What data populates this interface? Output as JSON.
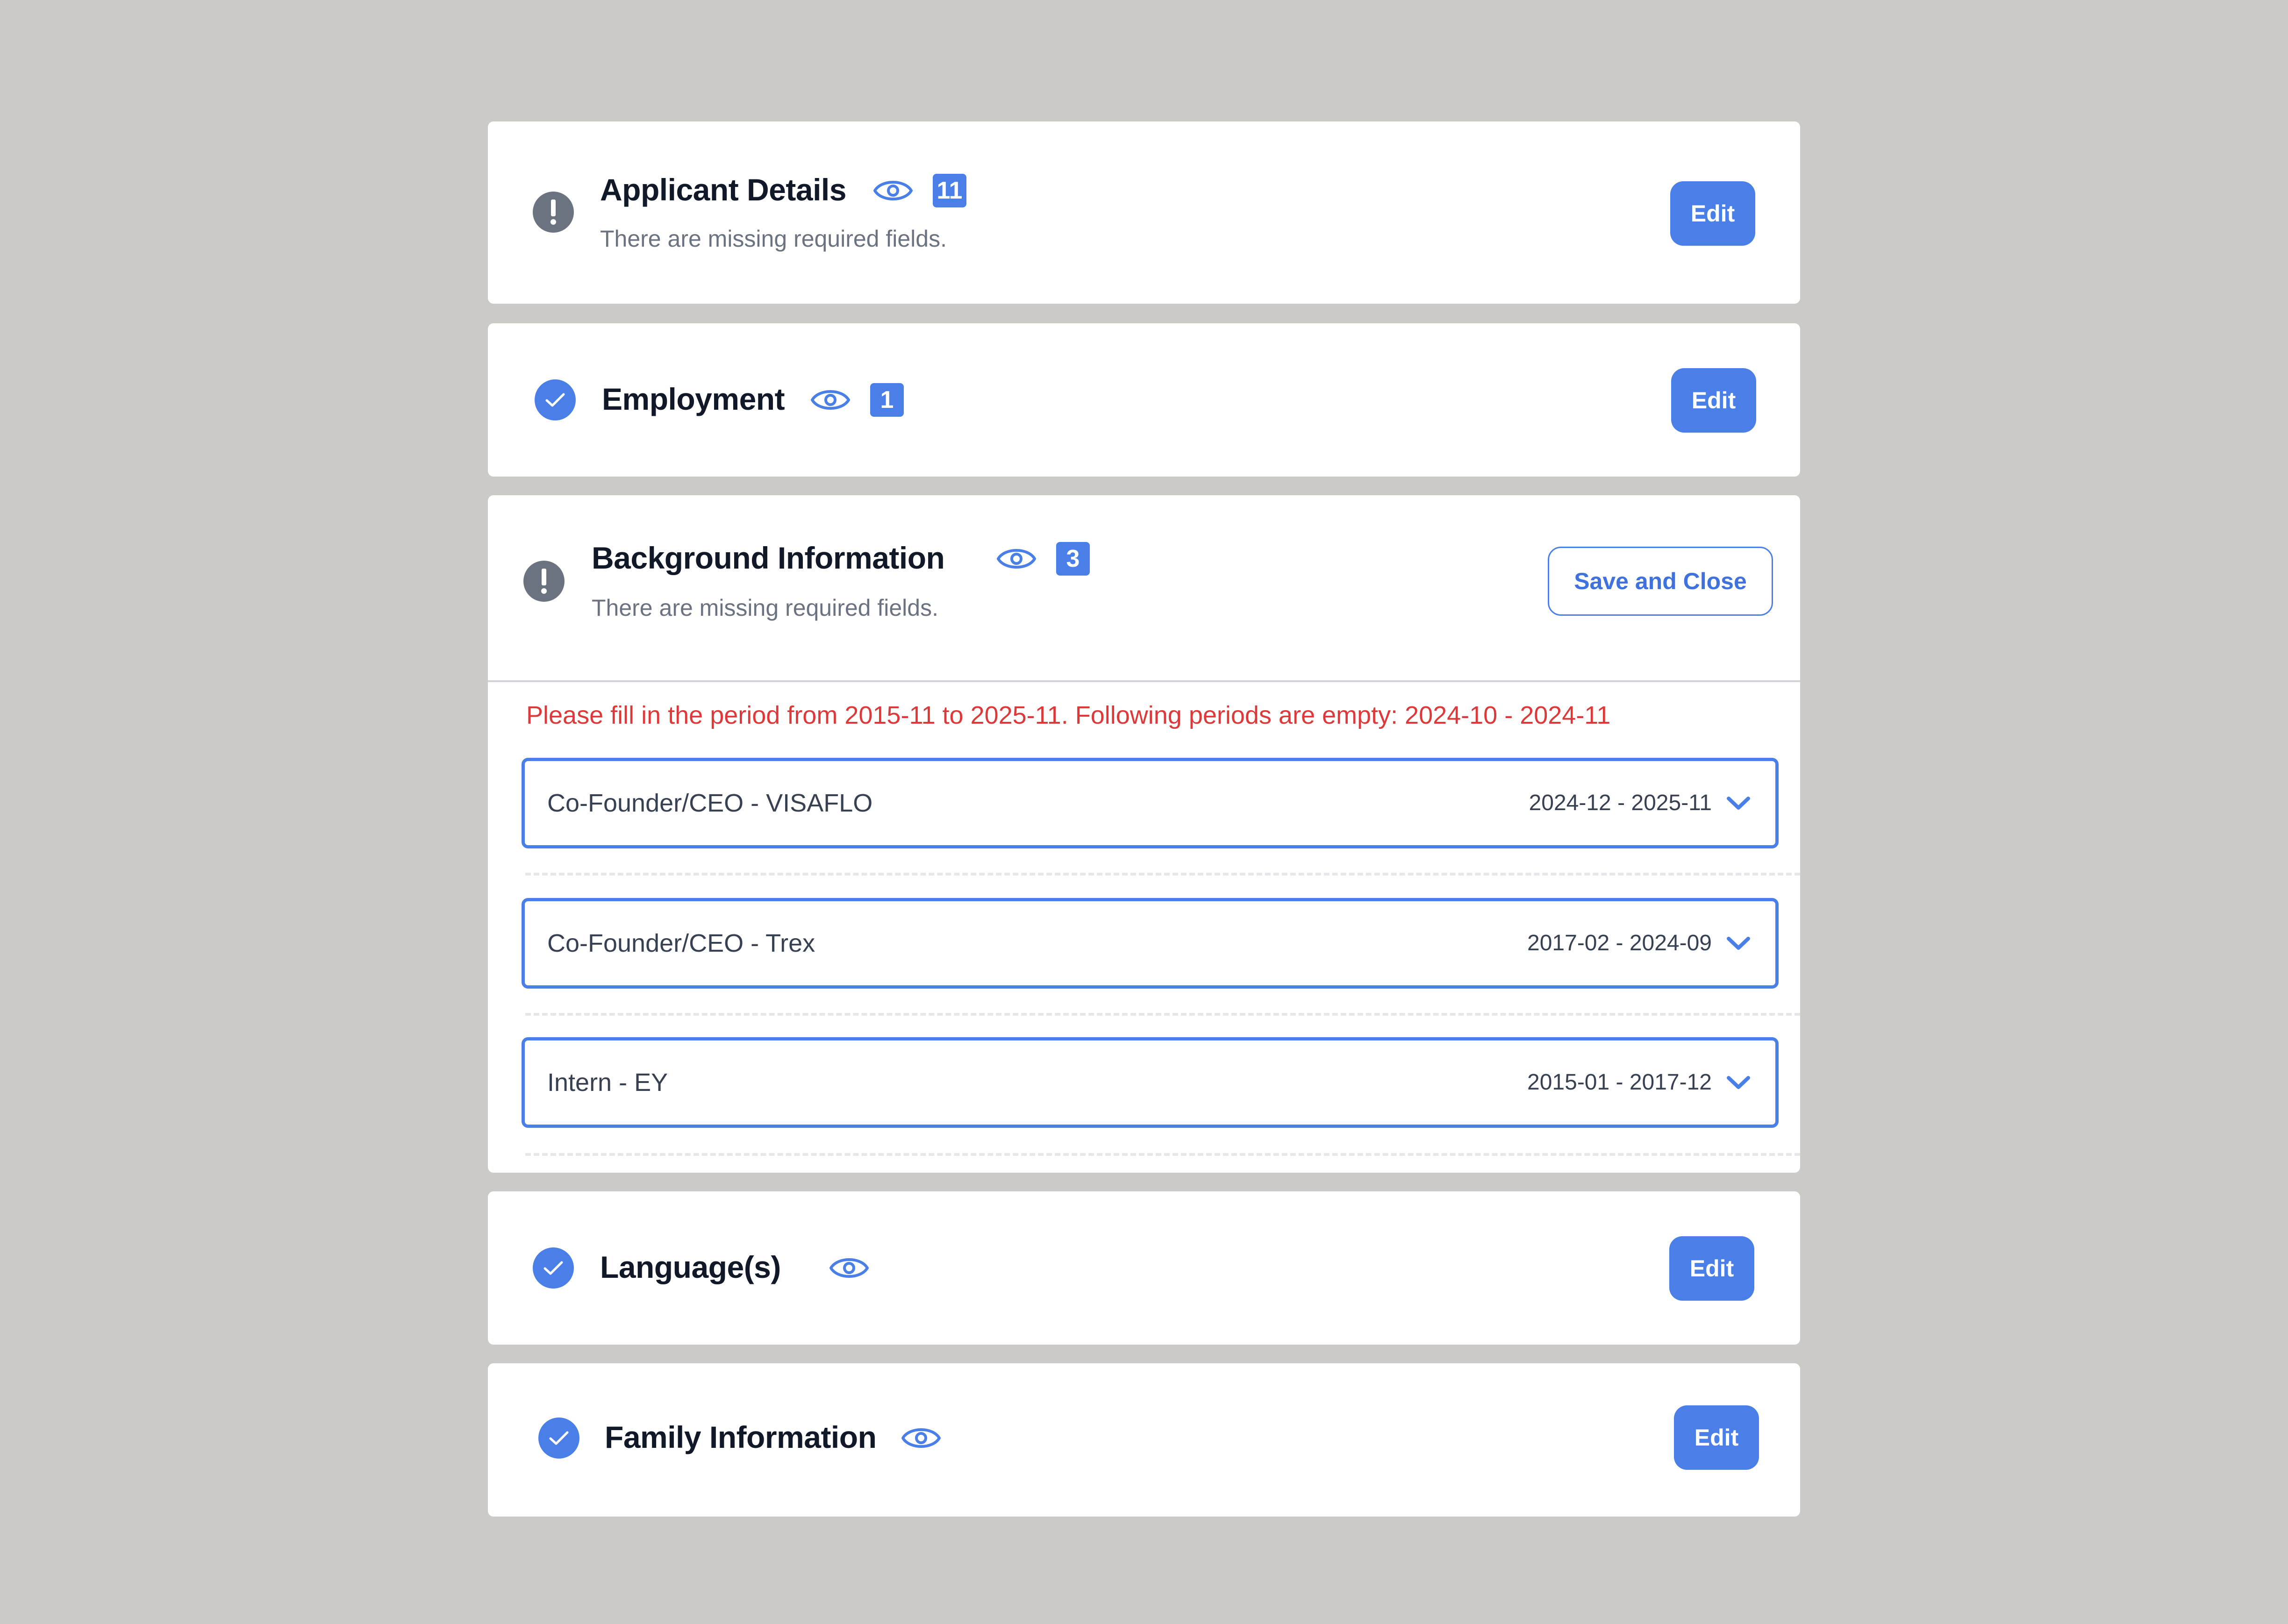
{
  "theme": {
    "accent": "#4a7fe8",
    "error": "#dc3a3a",
    "warning_gray": "#6b7280",
    "background": "#cbcac6"
  },
  "sections": {
    "applicant": {
      "title": "Applicant Details",
      "count": "11",
      "status": "warning",
      "status_icon": "exclamation-icon",
      "message": "There are missing required fields.",
      "action_label": "Edit"
    },
    "employment": {
      "title": "Employment",
      "count": "1",
      "status": "complete",
      "status_icon": "check-icon",
      "action_label": "Edit"
    },
    "background": {
      "title": "Background Information",
      "count": "3",
      "status": "warning",
      "status_icon": "exclamation-icon",
      "message": "There are missing required fields.",
      "action_label": "Save and Close",
      "error": "Please fill in the period from 2015-11 to 2025-11. Following periods are empty: 2024-10 - 2024-11",
      "entries": [
        {
          "label": "Co-Founder/CEO - VISAFLO",
          "period": "2024-12 - 2025-11"
        },
        {
          "label": "Co-Founder/CEO - Trex",
          "period": "2017-02 - 2024-09"
        },
        {
          "label": "Intern - EY",
          "period": "2015-01 - 2017-12"
        }
      ]
    },
    "languages": {
      "title": "Language(s)",
      "status": "complete",
      "status_icon": "check-icon",
      "action_label": "Edit"
    },
    "family": {
      "title": "Family Information",
      "status": "complete",
      "status_icon": "check-icon",
      "action_label": "Edit"
    }
  }
}
